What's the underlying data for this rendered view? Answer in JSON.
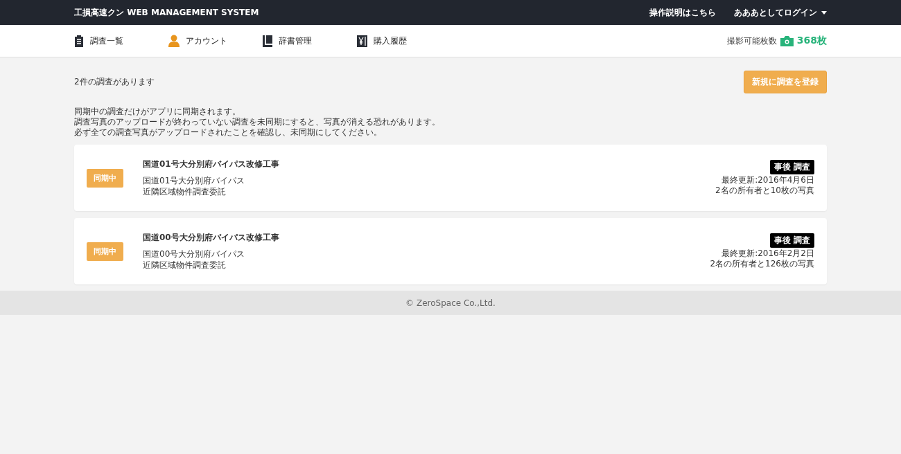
{
  "header": {
    "title": "工損高速クン WEB MANAGEMENT SYSTEM",
    "help_link": "操作説明はこちら",
    "user_menu": "あああとしてログイン"
  },
  "nav": {
    "items": [
      {
        "label": "調査一覧",
        "kind": "clipboard"
      },
      {
        "label": "アカウント",
        "kind": "person"
      },
      {
        "label": "辞書管理",
        "kind": "book"
      },
      {
        "label": "購入履歴",
        "kind": "yen"
      }
    ],
    "photo_quota": {
      "label": "撮影可能枚数",
      "value": "368枚"
    }
  },
  "summary": "2件の調査があります",
  "register_button": "新規に調査を登録",
  "notice": [
    "同期中の調査だけがアプリに同期されます。",
    "調査写真のアップロードが終わっていない調査を未同期にすると、写真が消える恐れがあります。",
    "必ず全ての調査写真がアップロードされたことを確認し、未同期にしてください。"
  ],
  "surveys": [
    {
      "status": "同期中",
      "title": "国道01号大分別府バイパス改修工事",
      "subtitle": "国道01号大分別府バイパス",
      "description": "近隣区域物件調査委託",
      "tag": "事後 調査",
      "updated": "最終更新:2016年4月6日",
      "counts": "2名の所有者と10枚の写真"
    },
    {
      "status": "同期中",
      "title": "国道00号大分別府バイパス改修工事",
      "subtitle": "国道00号大分別府バイパス",
      "description": "近隣区域物件調査委託",
      "tag": "事後 調査",
      "updated": "最終更新:2016年2月2日",
      "counts": "2名の所有者と126枚の写真"
    }
  ],
  "footer": "© ZeroSpace Co.,Ltd."
}
